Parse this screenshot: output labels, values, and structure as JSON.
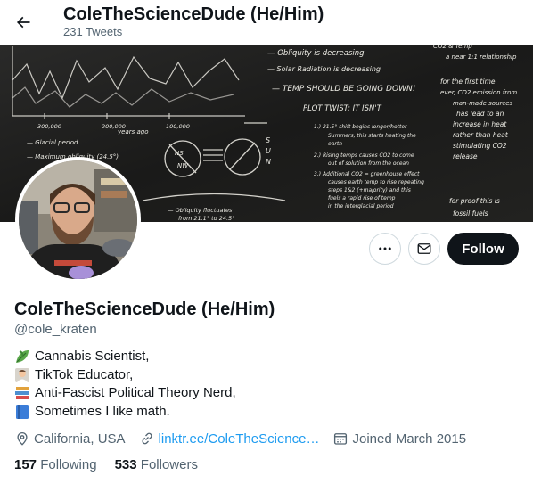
{
  "header": {
    "title": "ColeTheScienceDude (He/Him)",
    "subtitle": "231 Tweets",
    "back_icon": "arrow-left-icon"
  },
  "banner": {
    "description_lines": [
      "Obliquity is decreasing",
      "Solar Radiation is decreasing",
      "TEMP SHOULD BE GOING DOWN!",
      "PLOT TWIST: IT ISN'T",
      "Glacial period",
      "NS",
      "NW",
      "S U N",
      "Obliquity fluctuates",
      "from 21.1° to 24.5°",
      "a near 1:1 relationship",
      "for the first time",
      "ever, CO2 emission from",
      "man-made sources",
      "has lead to an",
      "increase in heat",
      "rather than heat",
      "stimulating CO2",
      "release",
      "for proof this is",
      "fossil fuels",
      "300,000",
      "200,000",
      "100,000",
      "years ago",
      "1.) 21.5° shift begins longer/hotter",
      "Summers, this starts heating the",
      "earth",
      "2.) Rising temps causes CO2 to come",
      "out of solution from the ocean",
      "3.) Additional CO2 = greenhouse effect",
      "causes earth temp to rise repeating",
      "steps 1&2 (+majority) and this",
      "fuels a rapid rise of temp",
      "in the interglacial period"
    ]
  },
  "avatar": {
    "name": "avatar"
  },
  "actions": {
    "more_icon": "more-horizontal-icon",
    "message_icon": "envelope-icon",
    "follow_label": "Follow"
  },
  "profile": {
    "name": "ColeTheScienceDude (He/Him)",
    "handle": "@cole_kraten",
    "bio": [
      {
        "icon": "leaf-emoji",
        "text": "Cannabis Scientist,"
      },
      {
        "icon": "scientist-emoji",
        "text": "TikTok Educator,"
      },
      {
        "icon": "books-emoji",
        "text": "Anti-Fascist Political Theory Nerd,"
      },
      {
        "icon": "blue-book-emoji",
        "text": "Sometimes I like math."
      }
    ],
    "location": "California, USA",
    "link": "linktr.ee/ColeTheScience…",
    "joined": "Joined March 2015",
    "following_count": "157",
    "following_label": "Following",
    "followers_count": "533",
    "followers_label": "Followers"
  },
  "colors": {
    "accent": "#1d9bf0",
    "text": "#0f1419",
    "secondary": "#536471",
    "follow_bg": "#0f1419",
    "banner_bg": "#1b1b1a"
  }
}
